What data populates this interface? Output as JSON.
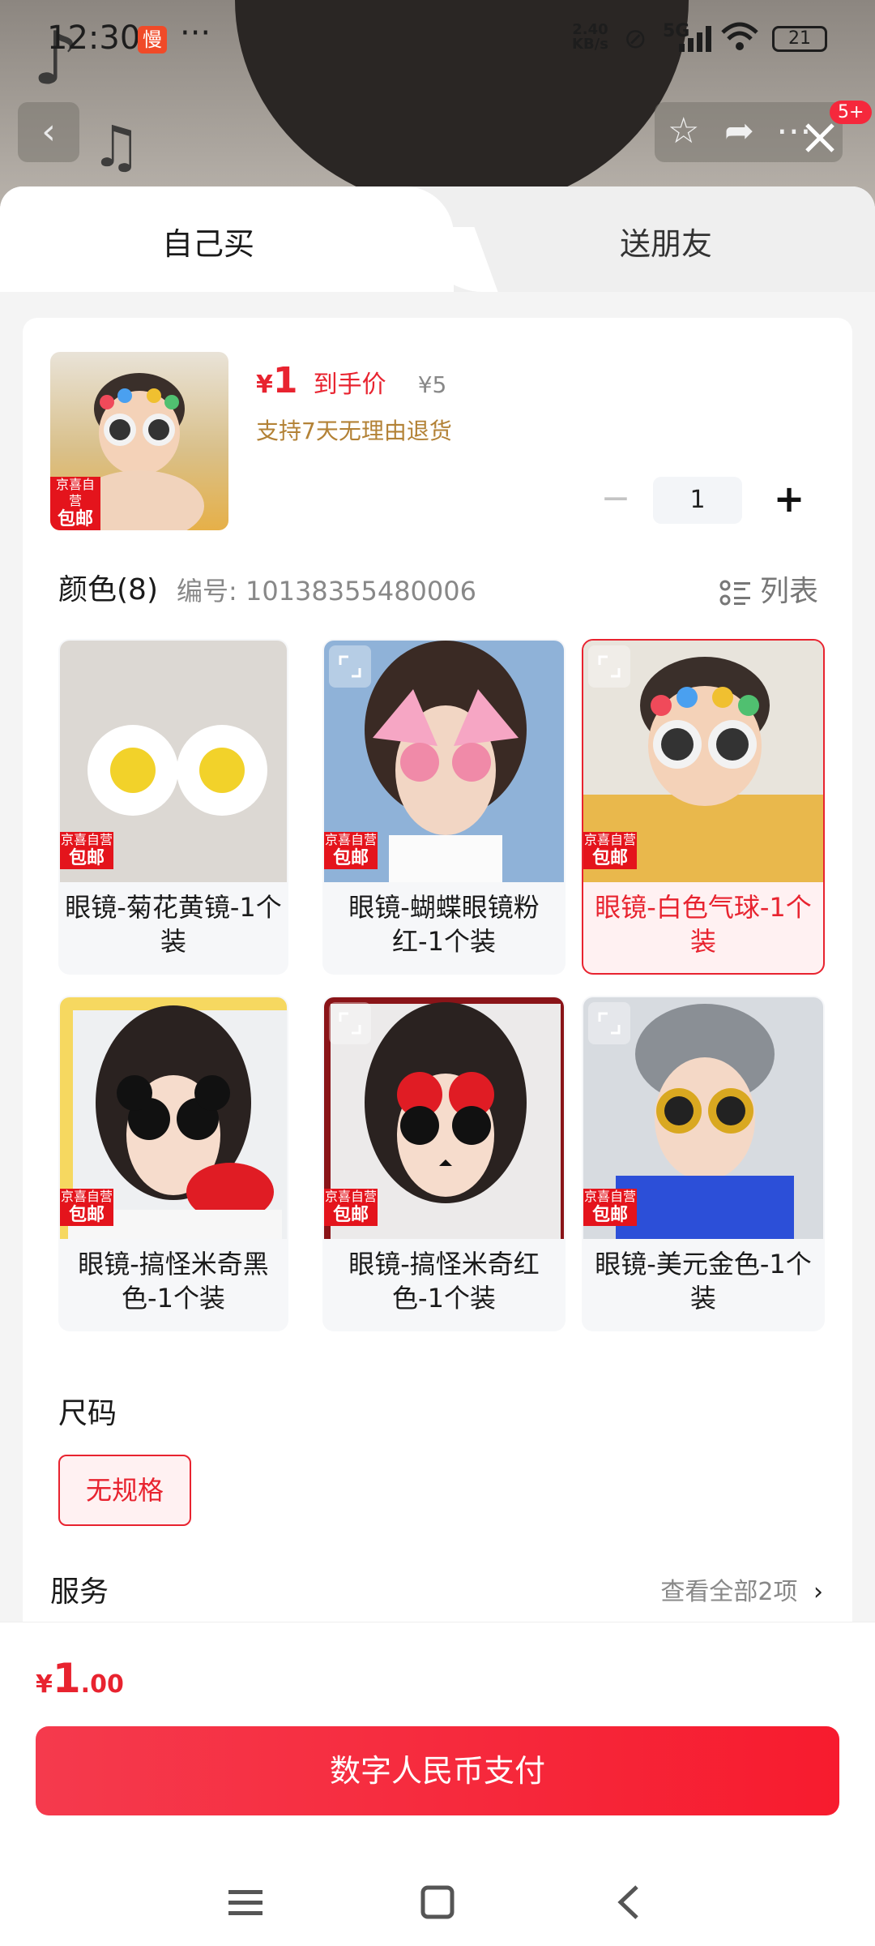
{
  "status_bar": {
    "time": "12:30",
    "slow_badge": "慢",
    "more_dots": "···",
    "net_speed_value": "2.40",
    "net_speed_unit": "KB/s",
    "network": "5G",
    "battery": "21"
  },
  "header": {
    "cart_badge": "5+"
  },
  "tabs": {
    "self_buy": "自己买",
    "gift_friend": "送朋友"
  },
  "product": {
    "price_currency": "¥",
    "price_value": "1",
    "price_tag": "到手价",
    "original_price": "¥5",
    "refund_policy": "支持7天无理由退货",
    "thumb_tag_top": "京喜自营",
    "thumb_tag_bottom": "包邮",
    "quantity": "1"
  },
  "color_section": {
    "title": "颜色(8)",
    "code": "编号: 10138355480006",
    "list_toggle": "列表",
    "options": [
      {
        "label": "眼镜-菊花黄镜-1个装",
        "tag_top": "京喜自营",
        "tag_bottom": "包邮",
        "selected": false
      },
      {
        "label": "眼镜-蝴蝶眼镜粉红-1个装",
        "tag_top": "京喜自营",
        "tag_bottom": "包邮",
        "selected": false
      },
      {
        "label": "眼镜-白色气球-1个装",
        "tag_top": "京喜自营",
        "tag_bottom": "包邮",
        "selected": true
      },
      {
        "label": "眼镜-搞怪米奇黑色-1个装",
        "tag_top": "京喜自营",
        "tag_bottom": "包邮",
        "selected": false
      },
      {
        "label": "眼镜-搞怪米奇红色-1个装",
        "tag_top": "京喜自营",
        "tag_bottom": "包邮",
        "selected": false
      },
      {
        "label": "眼镜-美元金色-1个装",
        "tag_top": "京喜自营",
        "tag_bottom": "包邮",
        "selected": false
      }
    ]
  },
  "size_section": {
    "title": "尺码",
    "option": "无规格"
  },
  "service_section": {
    "title": "服务",
    "view_all": "查看全部2项"
  },
  "footer": {
    "total_currency": "¥",
    "total_int": "1",
    "total_dec": ".00",
    "pay_button": "数字人民币支付"
  },
  "colors": {
    "accent": "#e8232f",
    "selected_bg": "#fff1f2",
    "refund_text": "#b38236"
  },
  "icons": [
    "back-icon",
    "star-icon",
    "share-icon",
    "more-icon",
    "close-icon",
    "list-icon",
    "expand-icon",
    "chevron-right-icon",
    "menu-nav-icon",
    "home-nav-icon",
    "back-nav-icon"
  ]
}
